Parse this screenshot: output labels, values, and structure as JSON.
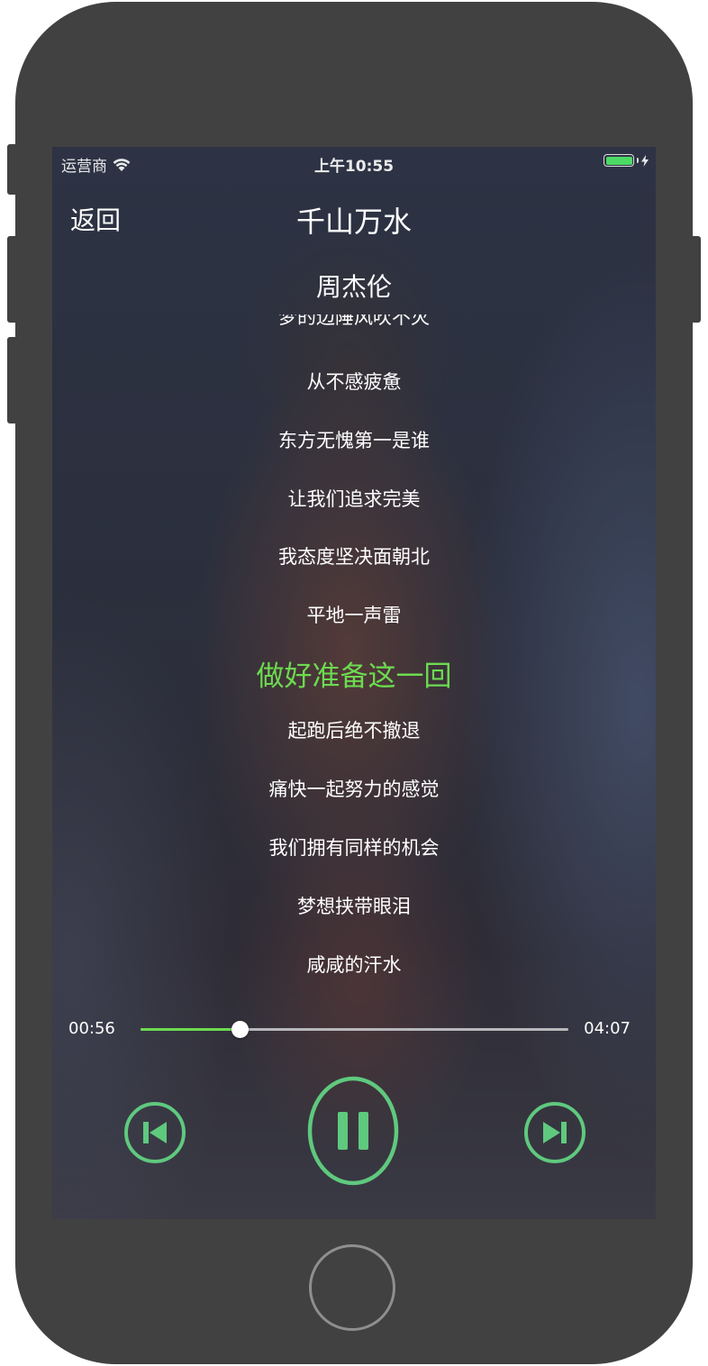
{
  "status_bar": {
    "carrier": "运营商",
    "time": "上午10:55"
  },
  "nav": {
    "back_label": "返回",
    "song_title": "千山万水",
    "artist": "周杰伦"
  },
  "lyrics": {
    "lines": [
      "梦的边陲风吹不灭",
      "从不感疲惫",
      "东方无愧第一是谁",
      "让我们追求完美",
      "我态度坚决面朝北",
      "平地一声雷",
      "做好准备这一回",
      "起跑后绝不撤退",
      "痛快一起努力的感觉",
      "我们拥有同样的机会",
      "梦想挟带眼泪",
      "咸咸的汗水"
    ],
    "current_index": 6
  },
  "player": {
    "elapsed": "00:56",
    "total": "04:07",
    "progress_fraction": 0.232,
    "state": "playing"
  },
  "colors": {
    "accent": "#6cdb4f",
    "control": "#5fc97e",
    "battery": "#4cd964",
    "phone_frame": "#414141"
  },
  "icons": {
    "wifi": "wifi-icon",
    "battery": "battery-icon",
    "charging": "bolt-icon",
    "previous": "skip-previous-icon",
    "pause": "pause-icon",
    "next": "skip-next-icon"
  }
}
